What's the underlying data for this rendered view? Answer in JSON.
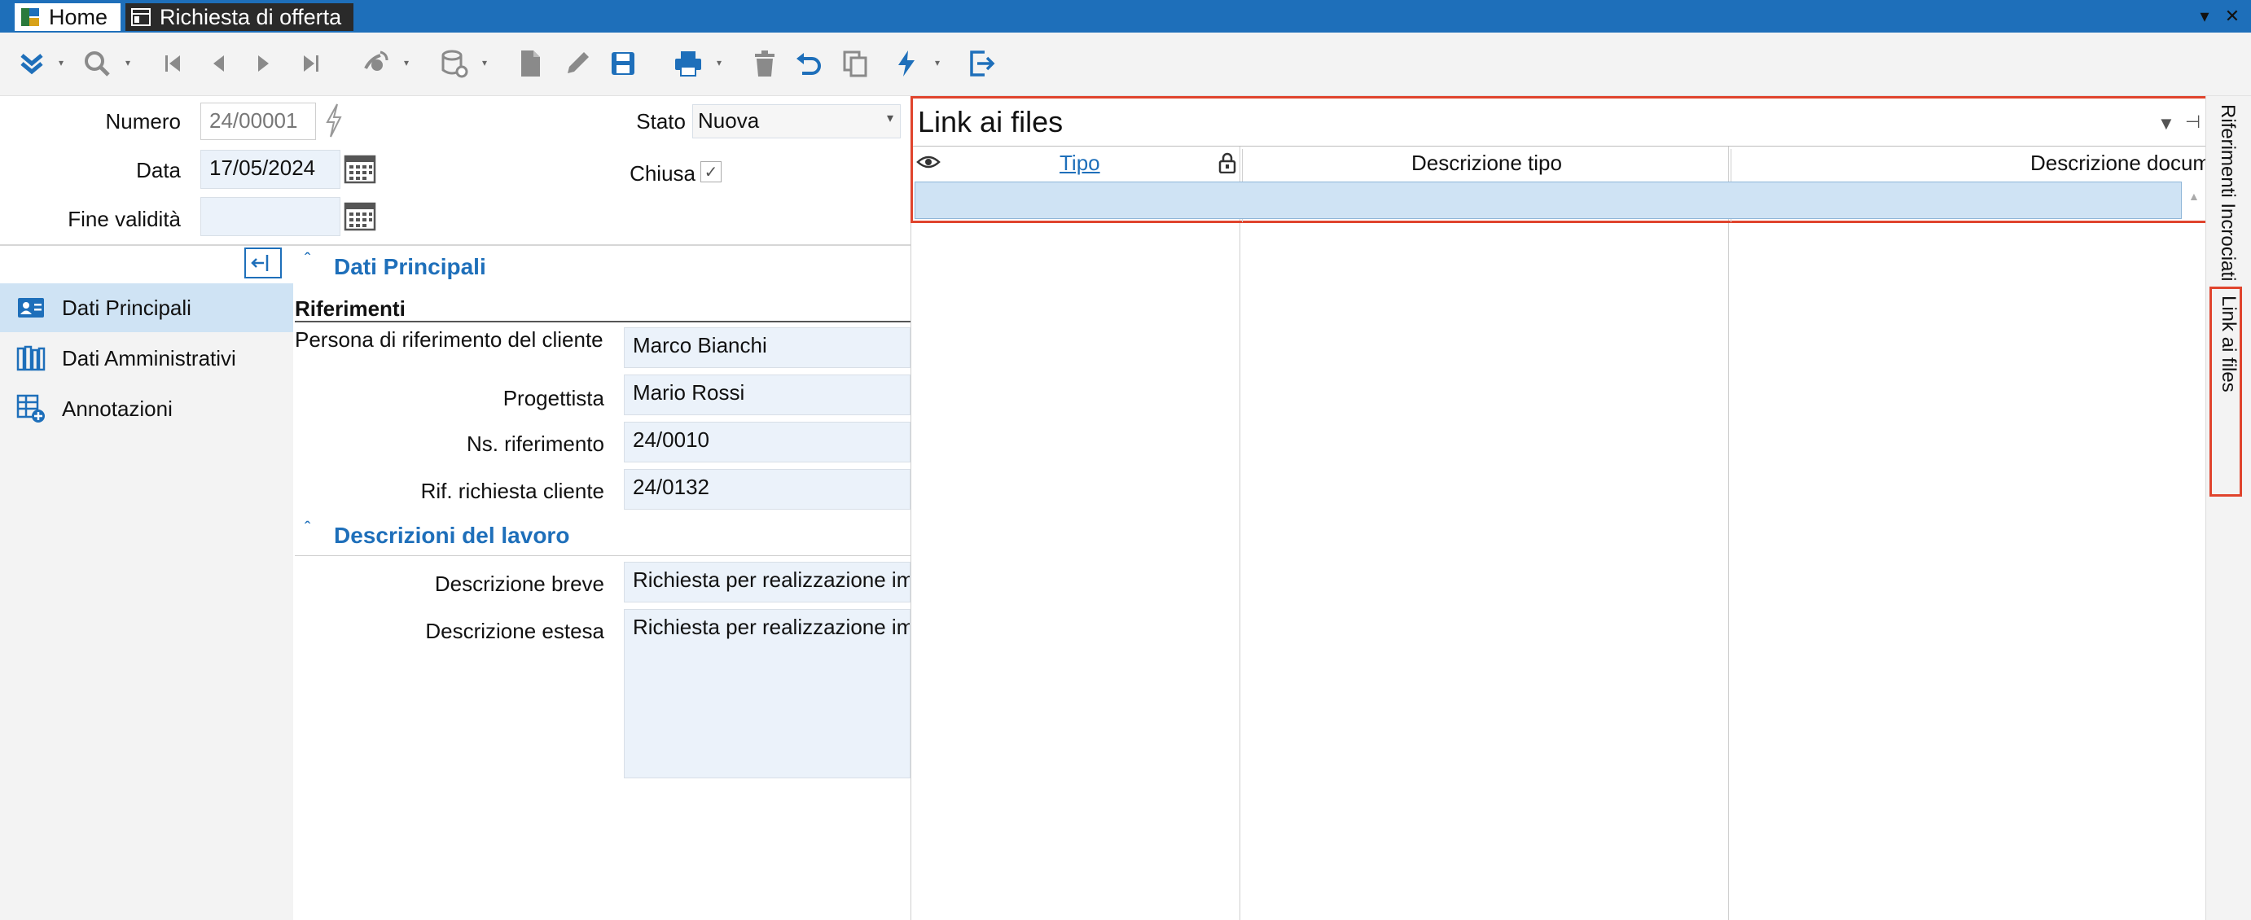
{
  "tabs": [
    {
      "label": "Home"
    },
    {
      "label": "Richiesta di offerta"
    }
  ],
  "window_controls": [
    "chevron-down",
    "close"
  ],
  "toolbar_icons": [
    "expand-all-icon",
    "search-icon",
    "first-icon",
    "previous-icon",
    "next-icon",
    "last-icon",
    "satellite-icon",
    "database-icon",
    "new-document-icon",
    "edit-icon",
    "save-icon",
    "print-icon",
    "delete-icon",
    "undo-icon",
    "copy-icon",
    "lightning-icon",
    "exit-icon"
  ],
  "header_form": {
    "numero_label": "Numero",
    "numero_value": "24/00001",
    "stato_label": "Stato",
    "stato_value": "Nuova",
    "data_label": "Data",
    "data_value": "17/05/2024",
    "chiusa_label": "Chiusa",
    "fine_validita_label": "Fine validità",
    "fine_validita_value": ""
  },
  "nav": [
    {
      "label": "Dati Principali",
      "active": true
    },
    {
      "label": "Dati Amministrativi",
      "active": false
    },
    {
      "label": "Annotazioni",
      "active": false
    }
  ],
  "section1": {
    "title": "Dati Principali",
    "subheader": "Riferimenti",
    "fields": [
      {
        "label": "Persona di riferimento del cliente",
        "value": "Marco Bianchi"
      },
      {
        "label": "Progettista",
        "value": "Mario Rossi"
      },
      {
        "label": "Ns. riferimento",
        "value": "24/0010"
      },
      {
        "label": "Rif. richiesta cliente",
        "value": "24/0132"
      }
    ]
  },
  "section2": {
    "title": "Descrizioni del lavoro",
    "fields": [
      {
        "label": "Descrizione breve",
        "value": "Richiesta per realizzazione im"
      },
      {
        "label": "Descrizione estesa",
        "value": "Richiesta per realizzazione im"
      }
    ]
  },
  "link_panel": {
    "title": "Link ai files",
    "columns": [
      "Tipo",
      "Descrizione tipo",
      "Descrizione docum"
    ]
  },
  "side_tabs": [
    "Riferimenti Incrociati",
    "Link ai files"
  ],
  "colors": {
    "accent": "#1e6fba",
    "highlight": "#e0442d",
    "selected_row": "#cfe3f4"
  }
}
